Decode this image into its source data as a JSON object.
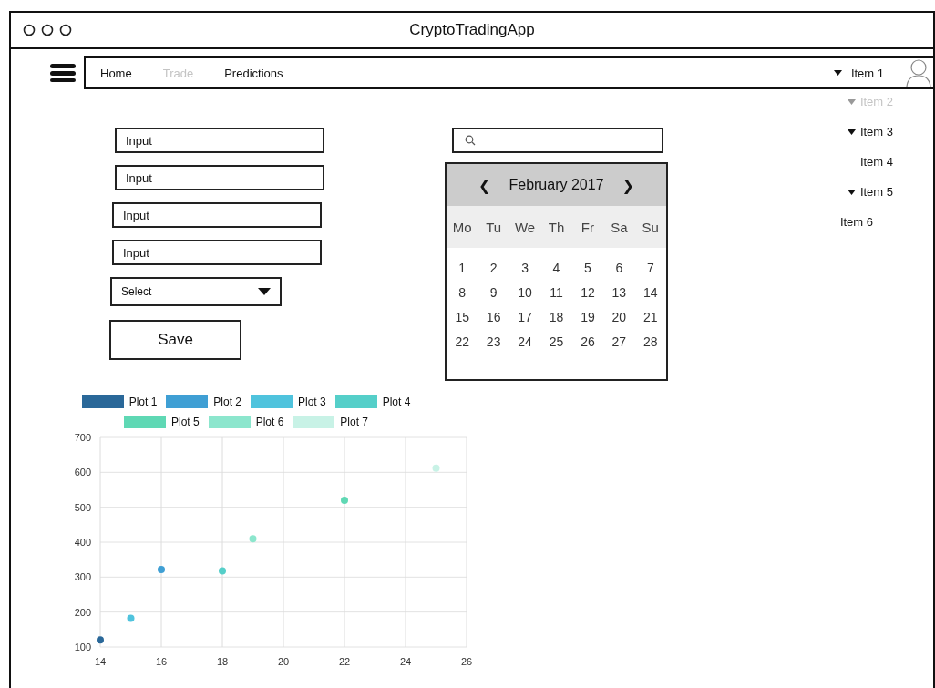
{
  "window": {
    "title": "CryptoTradingApp"
  },
  "nav": {
    "items": [
      {
        "label": "Home",
        "disabled": false
      },
      {
        "label": "Trade",
        "disabled": true
      },
      {
        "label": "Predictions",
        "disabled": false
      }
    ]
  },
  "menu": {
    "label": "Item 1",
    "caret": true,
    "disabled": false,
    "children": [
      {
        "label": "Item 2",
        "caret": true,
        "disabled": true
      },
      {
        "label": "Item 3",
        "caret": true,
        "disabled": false,
        "children": [
          {
            "label": "Item 4",
            "caret": false,
            "disabled": false
          }
        ]
      },
      {
        "label": "Item 5",
        "caret": true,
        "disabled": false,
        "children": [
          {
            "label": "Item 6",
            "caret": false,
            "disabled": false
          }
        ]
      }
    ]
  },
  "form": {
    "inputs": [
      {
        "value": "Input"
      },
      {
        "value": "Input"
      },
      {
        "value": "Input"
      },
      {
        "value": "Input"
      }
    ],
    "select": {
      "value": "Select"
    },
    "save": "Save"
  },
  "calendar": {
    "prev": "❮",
    "month": "February 2017",
    "next": "❯",
    "weekdays": [
      "Mo",
      "Tu",
      "We",
      "Th",
      "Fr",
      "Sa",
      "Su"
    ],
    "days": [
      "1",
      "2",
      "3",
      "4",
      "5",
      "6",
      "7",
      "8",
      "9",
      "10",
      "11",
      "12",
      "13",
      "14",
      "15",
      "16",
      "17",
      "18",
      "19",
      "20",
      "21",
      "22",
      "23",
      "24",
      "25",
      "26",
      "27",
      "28"
    ]
  },
  "chart": {
    "chart_data": {
      "type": "scatter",
      "grid": true,
      "xlim": [
        14,
        26
      ],
      "ylim": [
        100,
        700
      ],
      "xticks": [
        14,
        16,
        18,
        20,
        22,
        24,
        26
      ],
      "yticks": [
        100,
        200,
        300,
        400,
        500,
        600,
        700
      ],
      "series": [
        {
          "name": "Plot 1",
          "color": "#2a6899",
          "x": [
            14
          ],
          "values": [
            120
          ]
        },
        {
          "name": "Plot 2",
          "color": "#3f9fd4",
          "x": [
            16
          ],
          "values": [
            322
          ]
        },
        {
          "name": "Plot 3",
          "color": "#4fc3dd",
          "x": [
            15
          ],
          "values": [
            182
          ]
        },
        {
          "name": "Plot 4",
          "color": "#55cfc9",
          "x": [
            18
          ],
          "values": [
            318
          ]
        },
        {
          "name": "Plot 5",
          "color": "#5fd8b4",
          "x": [
            22
          ],
          "values": [
            520
          ]
        },
        {
          "name": "Plot 6",
          "color": "#8ce6cd",
          "x": [
            19
          ],
          "values": [
            410
          ]
        },
        {
          "name": "Plot 7",
          "color": "#c8f2e6",
          "x": [
            25
          ],
          "values": [
            612
          ]
        }
      ]
    }
  }
}
